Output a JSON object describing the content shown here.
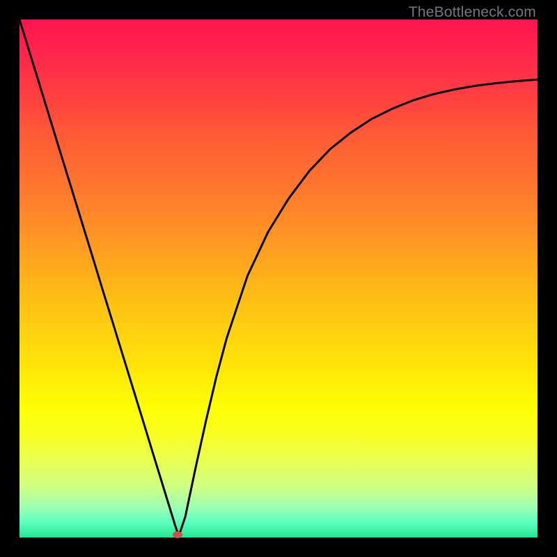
{
  "watermark": "TheBottleneck.com",
  "chart_data": {
    "type": "line",
    "title": "",
    "xlabel": "",
    "ylabel": "",
    "x": [
      0.0,
      0.02,
      0.04,
      0.06,
      0.08,
      0.1,
      0.12,
      0.14,
      0.16,
      0.18,
      0.2,
      0.22,
      0.24,
      0.26,
      0.28,
      0.3,
      0.305,
      0.31,
      0.32,
      0.34,
      0.36,
      0.38,
      0.4,
      0.44,
      0.48,
      0.52,
      0.56,
      0.6,
      0.64,
      0.68,
      0.72,
      0.76,
      0.8,
      0.84,
      0.88,
      0.92,
      0.96,
      1.0
    ],
    "values": [
      1.0,
      0.935,
      0.87,
      0.805,
      0.74,
      0.675,
      0.61,
      0.545,
      0.48,
      0.415,
      0.35,
      0.285,
      0.22,
      0.155,
      0.09,
      0.025,
      0.01,
      0.01,
      0.04,
      0.135,
      0.225,
      0.31,
      0.385,
      0.505,
      0.59,
      0.655,
      0.708,
      0.75,
      0.782,
      0.808,
      0.828,
      0.844,
      0.856,
      0.865,
      0.872,
      0.877,
      0.881,
      0.884
    ],
    "ylim": [
      0,
      1
    ],
    "xlim": [
      0,
      1
    ],
    "marker": {
      "x": 0.305,
      "y": 0.005
    }
  },
  "colors": {
    "curve": "#000000",
    "marker": "#d05045",
    "background_top": "#ff1450",
    "background_bottom": "#20e890"
  }
}
